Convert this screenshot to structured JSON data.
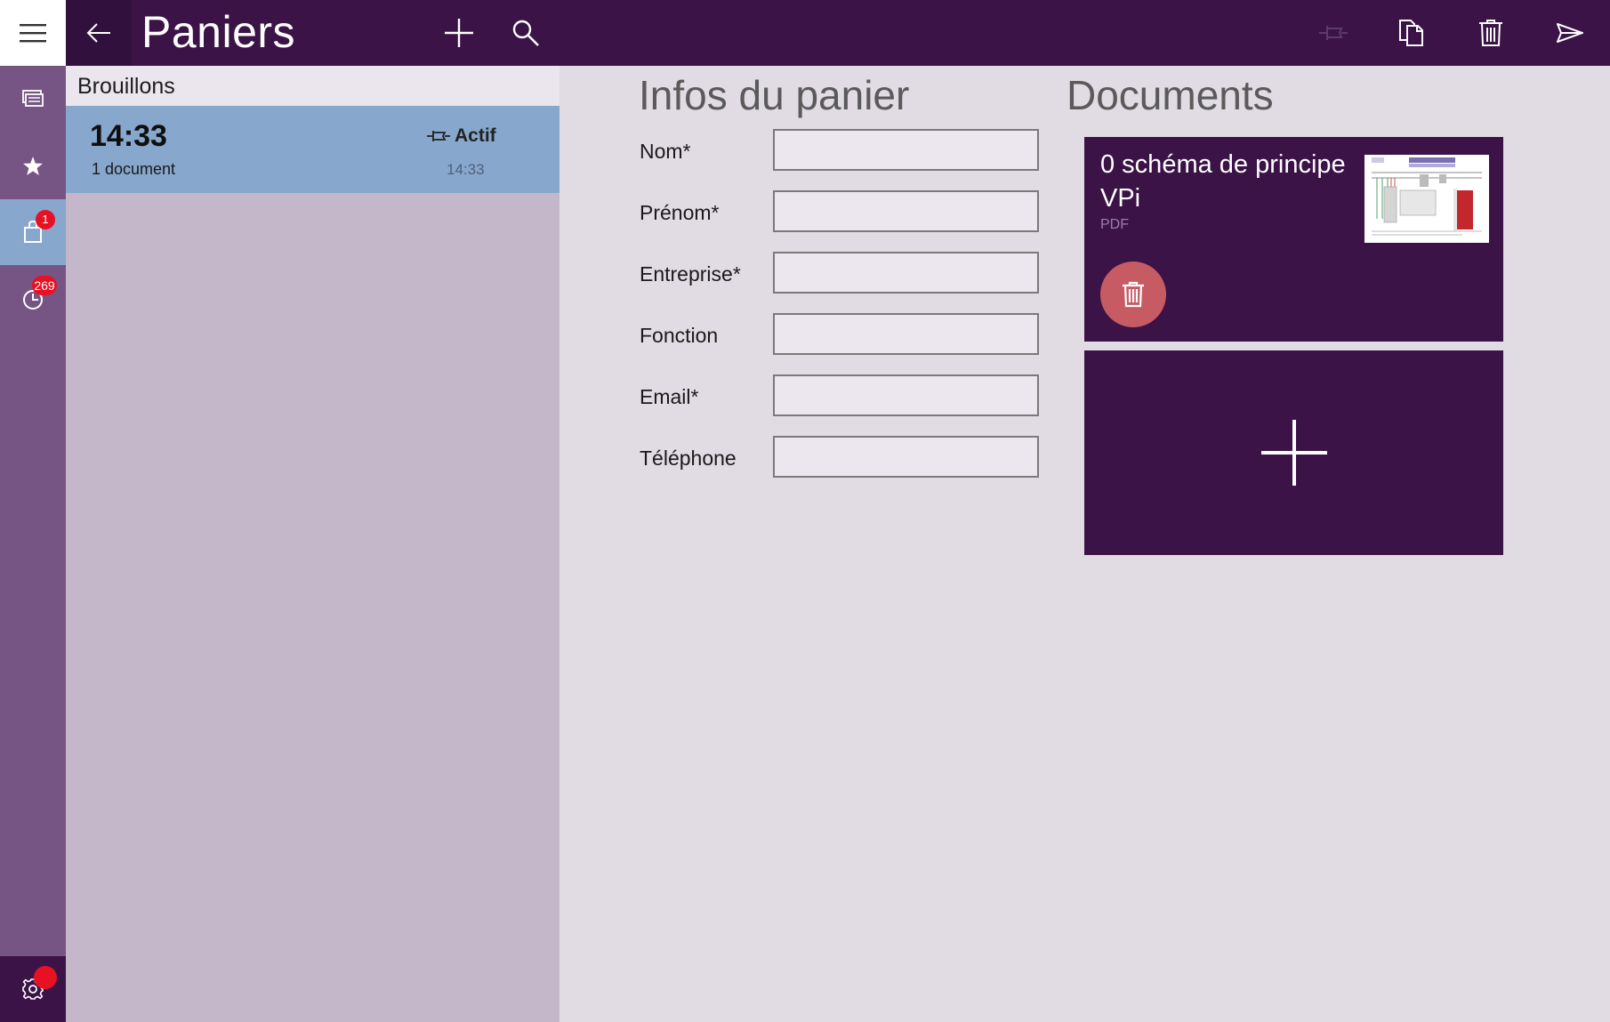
{
  "app": {
    "title": "Paniers"
  },
  "toolbar": {
    "icons": [
      "hamburger-icon",
      "back-arrow-icon",
      "plus-icon",
      "search-icon",
      "pin-icon",
      "copy-icon",
      "trash-icon",
      "send-icon"
    ]
  },
  "rail": {
    "items": [
      {
        "icon": "presentation-icon"
      },
      {
        "icon": "star-icon"
      },
      {
        "icon": "basket-icon",
        "badge": "1"
      },
      {
        "icon": "clock-icon",
        "badge": "269"
      }
    ],
    "settings_icon": "gear-icon"
  },
  "list": {
    "header": "Brouillons",
    "items": [
      {
        "time": "14:33",
        "documents": "1 document",
        "status": "Actif",
        "date": "14:33"
      }
    ]
  },
  "form": {
    "title": "Infos du panier",
    "fields": [
      {
        "label": "Nom*",
        "value": ""
      },
      {
        "label": "Prénom*",
        "value": ""
      },
      {
        "label": "Entreprise*",
        "value": ""
      },
      {
        "label": "Fonction",
        "value": ""
      },
      {
        "label": "Email*",
        "value": ""
      },
      {
        "label": "Téléphone",
        "value": ""
      }
    ]
  },
  "documents": {
    "title": "Documents",
    "items": [
      {
        "name": "0 schéma de principe VPi",
        "type": "PDF"
      }
    ]
  },
  "colors": {
    "topbar": "#3b1347",
    "rail": "#765584",
    "list_bg": "#c4b7ca",
    "selected_item": "#87a7cc",
    "content_bg": "#e1dbe3",
    "card": "#3b1347",
    "delete_button": "#c75b63",
    "badge": "#e81123"
  }
}
